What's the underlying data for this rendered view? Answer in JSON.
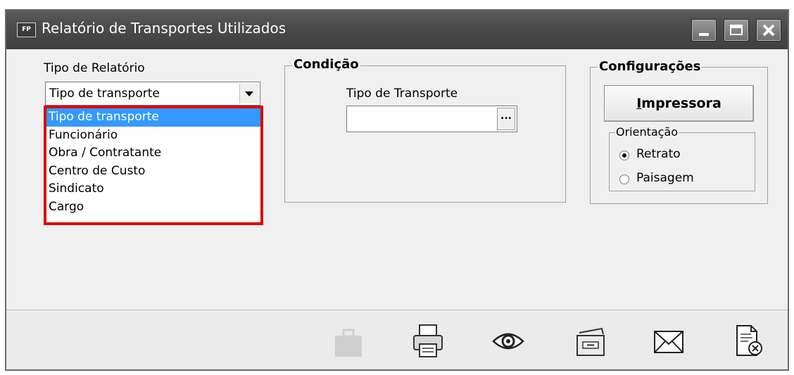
{
  "window": {
    "title": "Relatório de Transportes Utilizados",
    "icon_text": "FP",
    "controls": [
      "minimize-icon",
      "maximize-icon",
      "close-icon"
    ]
  },
  "report_type": {
    "label": "Tipo de Relatório",
    "selected": "Tipo de transporte",
    "options": [
      "Tipo de transporte",
      "Funcionário",
      "Obra / Contratante",
      "Centro de Custo",
      "Sindicato",
      "Cargo"
    ]
  },
  "condition": {
    "legend": "Condição",
    "transport_type_label": "Tipo de Transporte",
    "transport_type_value": "",
    "lookup_button": "..."
  },
  "settings": {
    "legend": "Configurações",
    "printer_button_prefix": "I",
    "printer_button_rest": "mpressora",
    "orientation_legend": "Orientação",
    "portrait_label": "Retrato",
    "landscape_label": "Paisagem",
    "orientation_selected": "Retrato"
  },
  "toolbar": {
    "icons": [
      "briefcase-icon",
      "printer-icon",
      "preview-eye-icon",
      "folder-drawer-icon",
      "envelope-icon",
      "close-document-icon"
    ]
  },
  "colors": {
    "titlebar": "#4a4a4a",
    "selection": "#3399ff",
    "highlight_border": "#e00000"
  }
}
